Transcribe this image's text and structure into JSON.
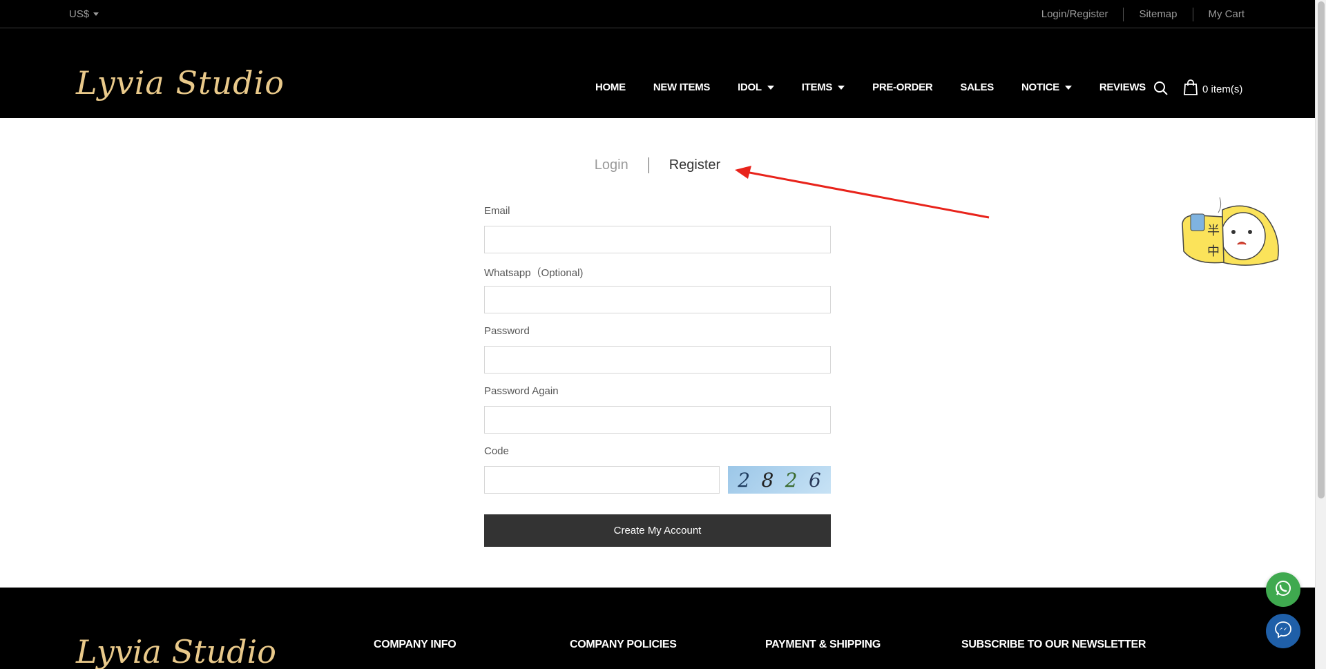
{
  "topbar": {
    "currency": "US$",
    "links": [
      "Login/Register",
      "Sitemap",
      "My Cart"
    ]
  },
  "header": {
    "logo": "Lyvia Studio",
    "nav": [
      {
        "label": "HOME",
        "dropdown": false
      },
      {
        "label": "NEW ITEMS",
        "dropdown": false
      },
      {
        "label": "IDOL",
        "dropdown": true
      },
      {
        "label": "ITEMS",
        "dropdown": true
      },
      {
        "label": "PRE-ORDER",
        "dropdown": false
      },
      {
        "label": "SALES",
        "dropdown": false
      },
      {
        "label": "NOTICE",
        "dropdown": true
      },
      {
        "label": "REVIEWS",
        "dropdown": false
      }
    ],
    "cart_label": "0 item(s)"
  },
  "tabs": {
    "login": "Login",
    "register": "Register"
  },
  "form": {
    "email_label": "Email",
    "whatsapp_label": "Whatsapp（Optional)",
    "password_label": "Password",
    "password_again_label": "Password Again",
    "code_label": "Code",
    "captcha_chars": [
      "2",
      "8",
      "2",
      "6"
    ],
    "submit_label": "Create My Account"
  },
  "mascot": {
    "glyphs": [
      "半",
      "中"
    ]
  },
  "footer": {
    "logo": "Lyvia Studio",
    "headings": [
      "COMPANY INFO",
      "COMPANY POLICIES",
      "PAYMENT & SHIPPING",
      "SUBSCRIBE TO OUR NEWSLETTER"
    ]
  },
  "colors": {
    "header_bg": "#000000",
    "logo_gold": "#e9c98a",
    "button_dark": "#333333",
    "annotation_red": "#e8231b",
    "whatsapp_green": "#3fa94f",
    "messenger_blue": "#1f5fa8"
  }
}
